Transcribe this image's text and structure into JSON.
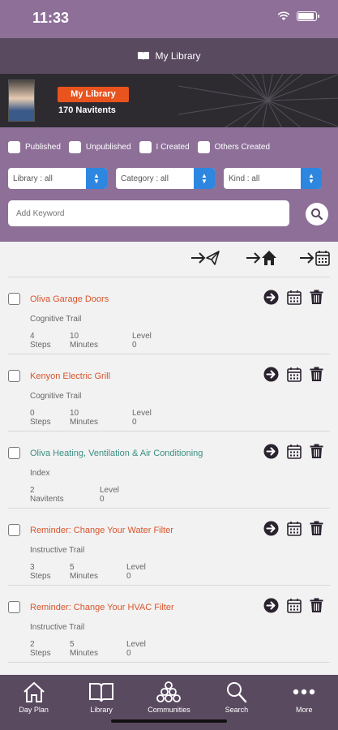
{
  "status_bar": {
    "time": "11:33"
  },
  "header": {
    "title": "My Library",
    "title_icon": "book-icon"
  },
  "profile": {
    "badge": "My Library",
    "count": "170 Navitents"
  },
  "filters": {
    "checkboxes": [
      "Published",
      "Unpublished",
      "I Created",
      "Others Created"
    ],
    "selects": [
      {
        "label": "Library : all"
      },
      {
        "label": "Category : all"
      },
      {
        "label": "Kind : all"
      }
    ],
    "search": {
      "placeholder": "Add Keyword"
    }
  },
  "toolbar_icons": [
    "send-to-icon",
    "send-home-icon",
    "send-calendar-icon"
  ],
  "items": [
    {
      "title": "Oliva Garage Doors",
      "color": "#d9542c",
      "type": "Cognitive Trail",
      "meta": [
        "4 Steps",
        "10 Minutes",
        "Level 0"
      ]
    },
    {
      "title": "Kenyon Electric Grill",
      "color": "#d9542c",
      "type": "Cognitive Trail",
      "meta": [
        "0 Steps",
        "10 Minutes",
        "Level 0"
      ]
    },
    {
      "title": "Oliva Heating, Ventilation & Air Conditioning",
      "color": "#3a8f84",
      "type": "Index",
      "meta": [
        "2 Navitents",
        "Level 0"
      ]
    },
    {
      "title": "Reminder: Change Your Water Filter",
      "color": "#d9542c",
      "type": "Instructive Trail",
      "meta": [
        "3 Steps",
        "5 Minutes",
        "Level 0"
      ]
    },
    {
      "title": "Reminder: Change Your HVAC Filter",
      "color": "#d9542c",
      "type": "Instructive Trail",
      "meta": [
        "2 Steps",
        "5 Minutes",
        "Level 0"
      ]
    }
  ],
  "tabs": [
    {
      "label": "Day Plan",
      "icon": "house-icon"
    },
    {
      "label": "Library",
      "icon": "book-icon"
    },
    {
      "label": "Communities",
      "icon": "communities-icon"
    },
    {
      "label": "Search",
      "icon": "magnifier-icon"
    },
    {
      "label": "More",
      "icon": "more-icon"
    }
  ],
  "colors": {
    "purple": "#8d6f98",
    "dark_purple": "#5a4a60",
    "orange": "#e8531e",
    "blue": "#2d86e0"
  }
}
